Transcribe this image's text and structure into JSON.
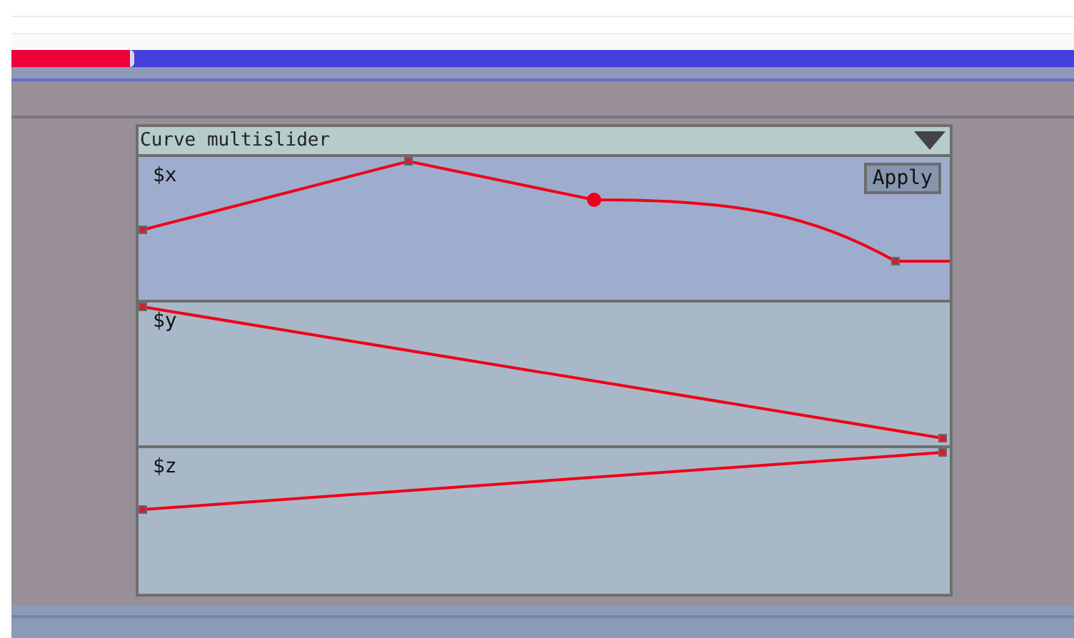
{
  "progress": {
    "level": 0.115
  },
  "panel": {
    "title": "Curve multislider"
  },
  "curves": [
    {
      "label": "$x",
      "selected": true,
      "button": "Apply"
    },
    {
      "label": "$y",
      "selected": false
    },
    {
      "label": "$z",
      "selected": false
    }
  ]
}
